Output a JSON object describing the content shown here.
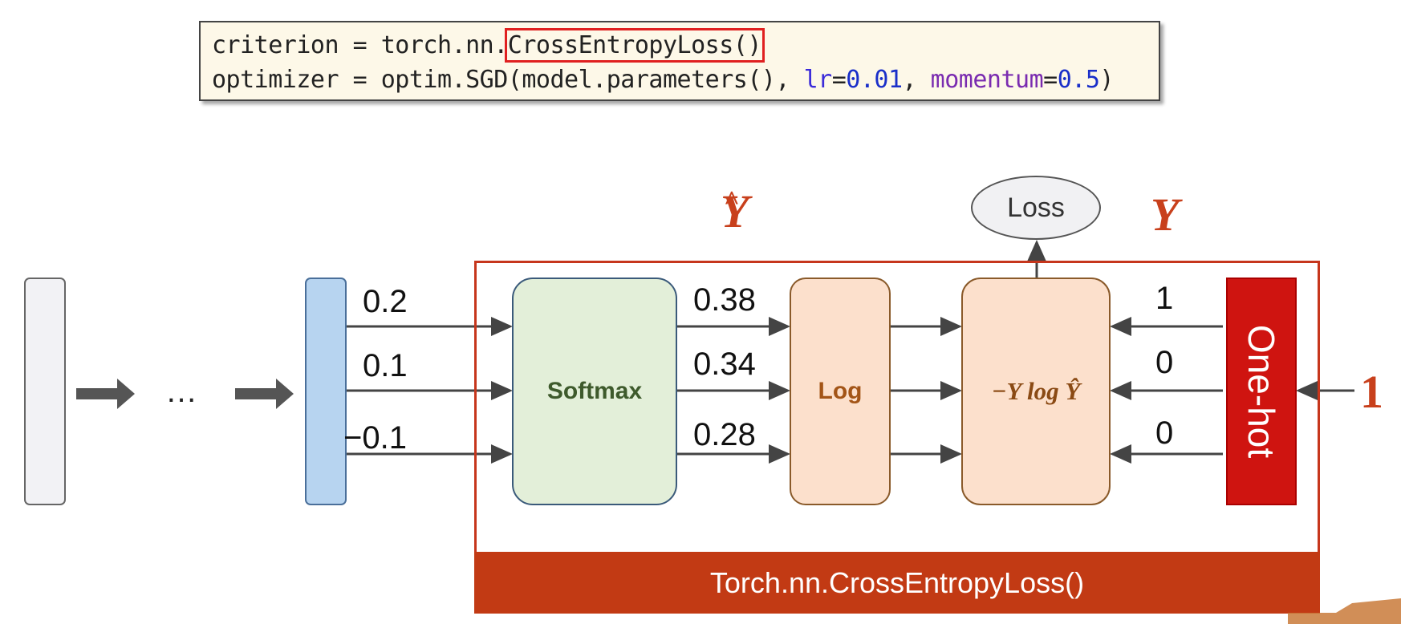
{
  "code": {
    "line1": {
      "prefix": "criterion = torch.nn.",
      "highlighted": "CrossEntropyLoss()"
    },
    "line2": {
      "prefix": "optimizer = optim.SGD(model.parameters(), ",
      "lr_key": "lr",
      "lr_eq": "=",
      "lr_value": "0.01",
      "sep": ", ",
      "momentum_key": "momentum",
      "momentum_eq": "=",
      "momentum_value": "0.5",
      "suffix": ")"
    }
  },
  "diagram": {
    "ellipsis": "…",
    "logits": [
      "0.2",
      "0.1",
      "−0.1"
    ],
    "softmax_label": "Softmax",
    "probabilities": [
      "0.38",
      "0.34",
      "0.28"
    ],
    "log_label": "Log",
    "nll_label": "−Y log Ŷ",
    "loss_label": "Loss",
    "y_hat_label": "Y",
    "y_hat_caret": "^",
    "y_label": "Y",
    "one_hot_values": [
      "1",
      "0",
      "0"
    ],
    "one_hot_label": "One-hot",
    "class_index": "1",
    "banner": "Torch.nn.CrossEntropyLoss()"
  },
  "colors": {
    "accent_red": "#c8401c",
    "onehot_red": "#cf1410",
    "banner": "#c23a14",
    "softmax_fill": "#e3efd9",
    "log_fill": "#fce0cc",
    "output_fill": "#b7d4f0"
  }
}
